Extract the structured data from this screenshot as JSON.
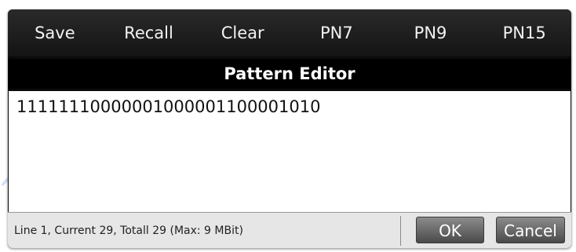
{
  "toolbar": {
    "buttons": [
      "Save",
      "Recall",
      "Clear",
      "PN7",
      "PN9",
      "PN15"
    ]
  },
  "dialog": {
    "title": "Pattern Editor"
  },
  "editor": {
    "value": "11111110000001000001100001010"
  },
  "status": {
    "text": "Line 1, Current 29, Totall 29 (Max: 9 MBit)"
  },
  "buttons": {
    "ok": "OK",
    "cancel": "Cancel"
  },
  "colors": {
    "toolbar_bg": "#1e1e1e",
    "title_bg": "#000000",
    "status_bg": "#e6e6e6",
    "button_gradient_top": "#8c8c8c",
    "button_gradient_bottom": "#4a4a4a"
  }
}
